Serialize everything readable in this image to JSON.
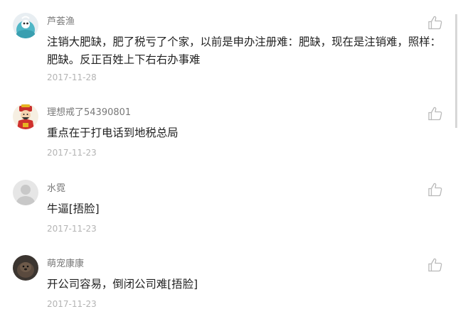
{
  "comments": [
    {
      "username": "芦荟渔",
      "text": "注销大肥缺，肥了税亏了个家，以前是申办注册难：肥缺，现在是注销难，照样：肥缺。反正百姓上下右右办事难",
      "date": "2017-11-28",
      "avatar": "teal-cartoon-avatar"
    },
    {
      "username": "理想戒了54390801",
      "text": "重点在于打电话到地税总局",
      "date": "2017-11-23",
      "avatar": "fortune-god-avatar"
    },
    {
      "username": "水霓",
      "text": "牛逼[捂脸]",
      "date": "2017-11-23",
      "avatar": "default-gray-avatar"
    },
    {
      "username": "萌宠康康",
      "text": "开公司容易，倒闭公司难[捂脸]",
      "date": "2017-11-23",
      "avatar": "dark-pet-photo-avatar"
    }
  ],
  "icons": {
    "like": "thumbs-up-icon"
  },
  "colors": {
    "username": "#787878",
    "text": "#222222",
    "date": "#b4b4b4",
    "icon": "#b9b9b9"
  }
}
